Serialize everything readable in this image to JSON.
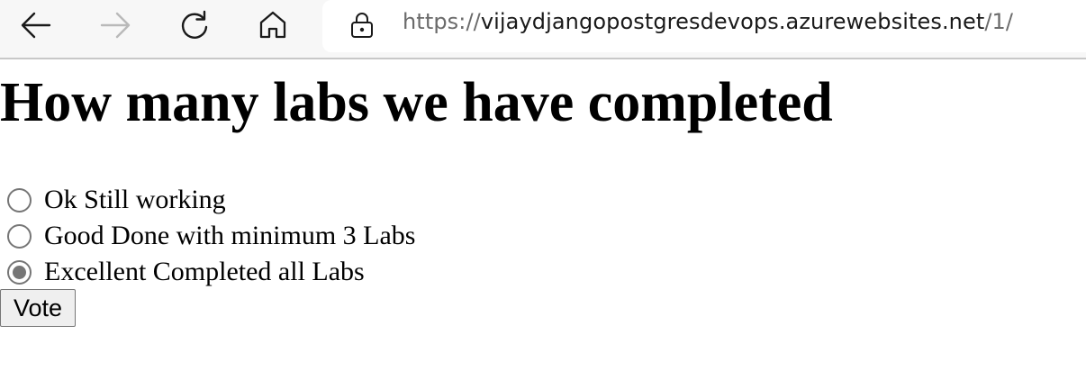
{
  "browser": {
    "url": {
      "scheme": "https://",
      "host": "vijaydjangopostgresdevops.azurewebsites.net",
      "path": "/1/"
    },
    "icons": {
      "back": "arrow-left-icon",
      "forward": "arrow-right-icon",
      "refresh": "refresh-icon",
      "home": "home-icon",
      "lock": "lock-icon"
    }
  },
  "poll": {
    "question": "How many labs we have completed",
    "choices": [
      {
        "label": "Ok Still working",
        "checked": false
      },
      {
        "label": "Good Done with minimum 3 Labs",
        "checked": false
      },
      {
        "label": "Excellent Completed all Labs",
        "checked": true
      }
    ],
    "submit_label": "Vote"
  }
}
